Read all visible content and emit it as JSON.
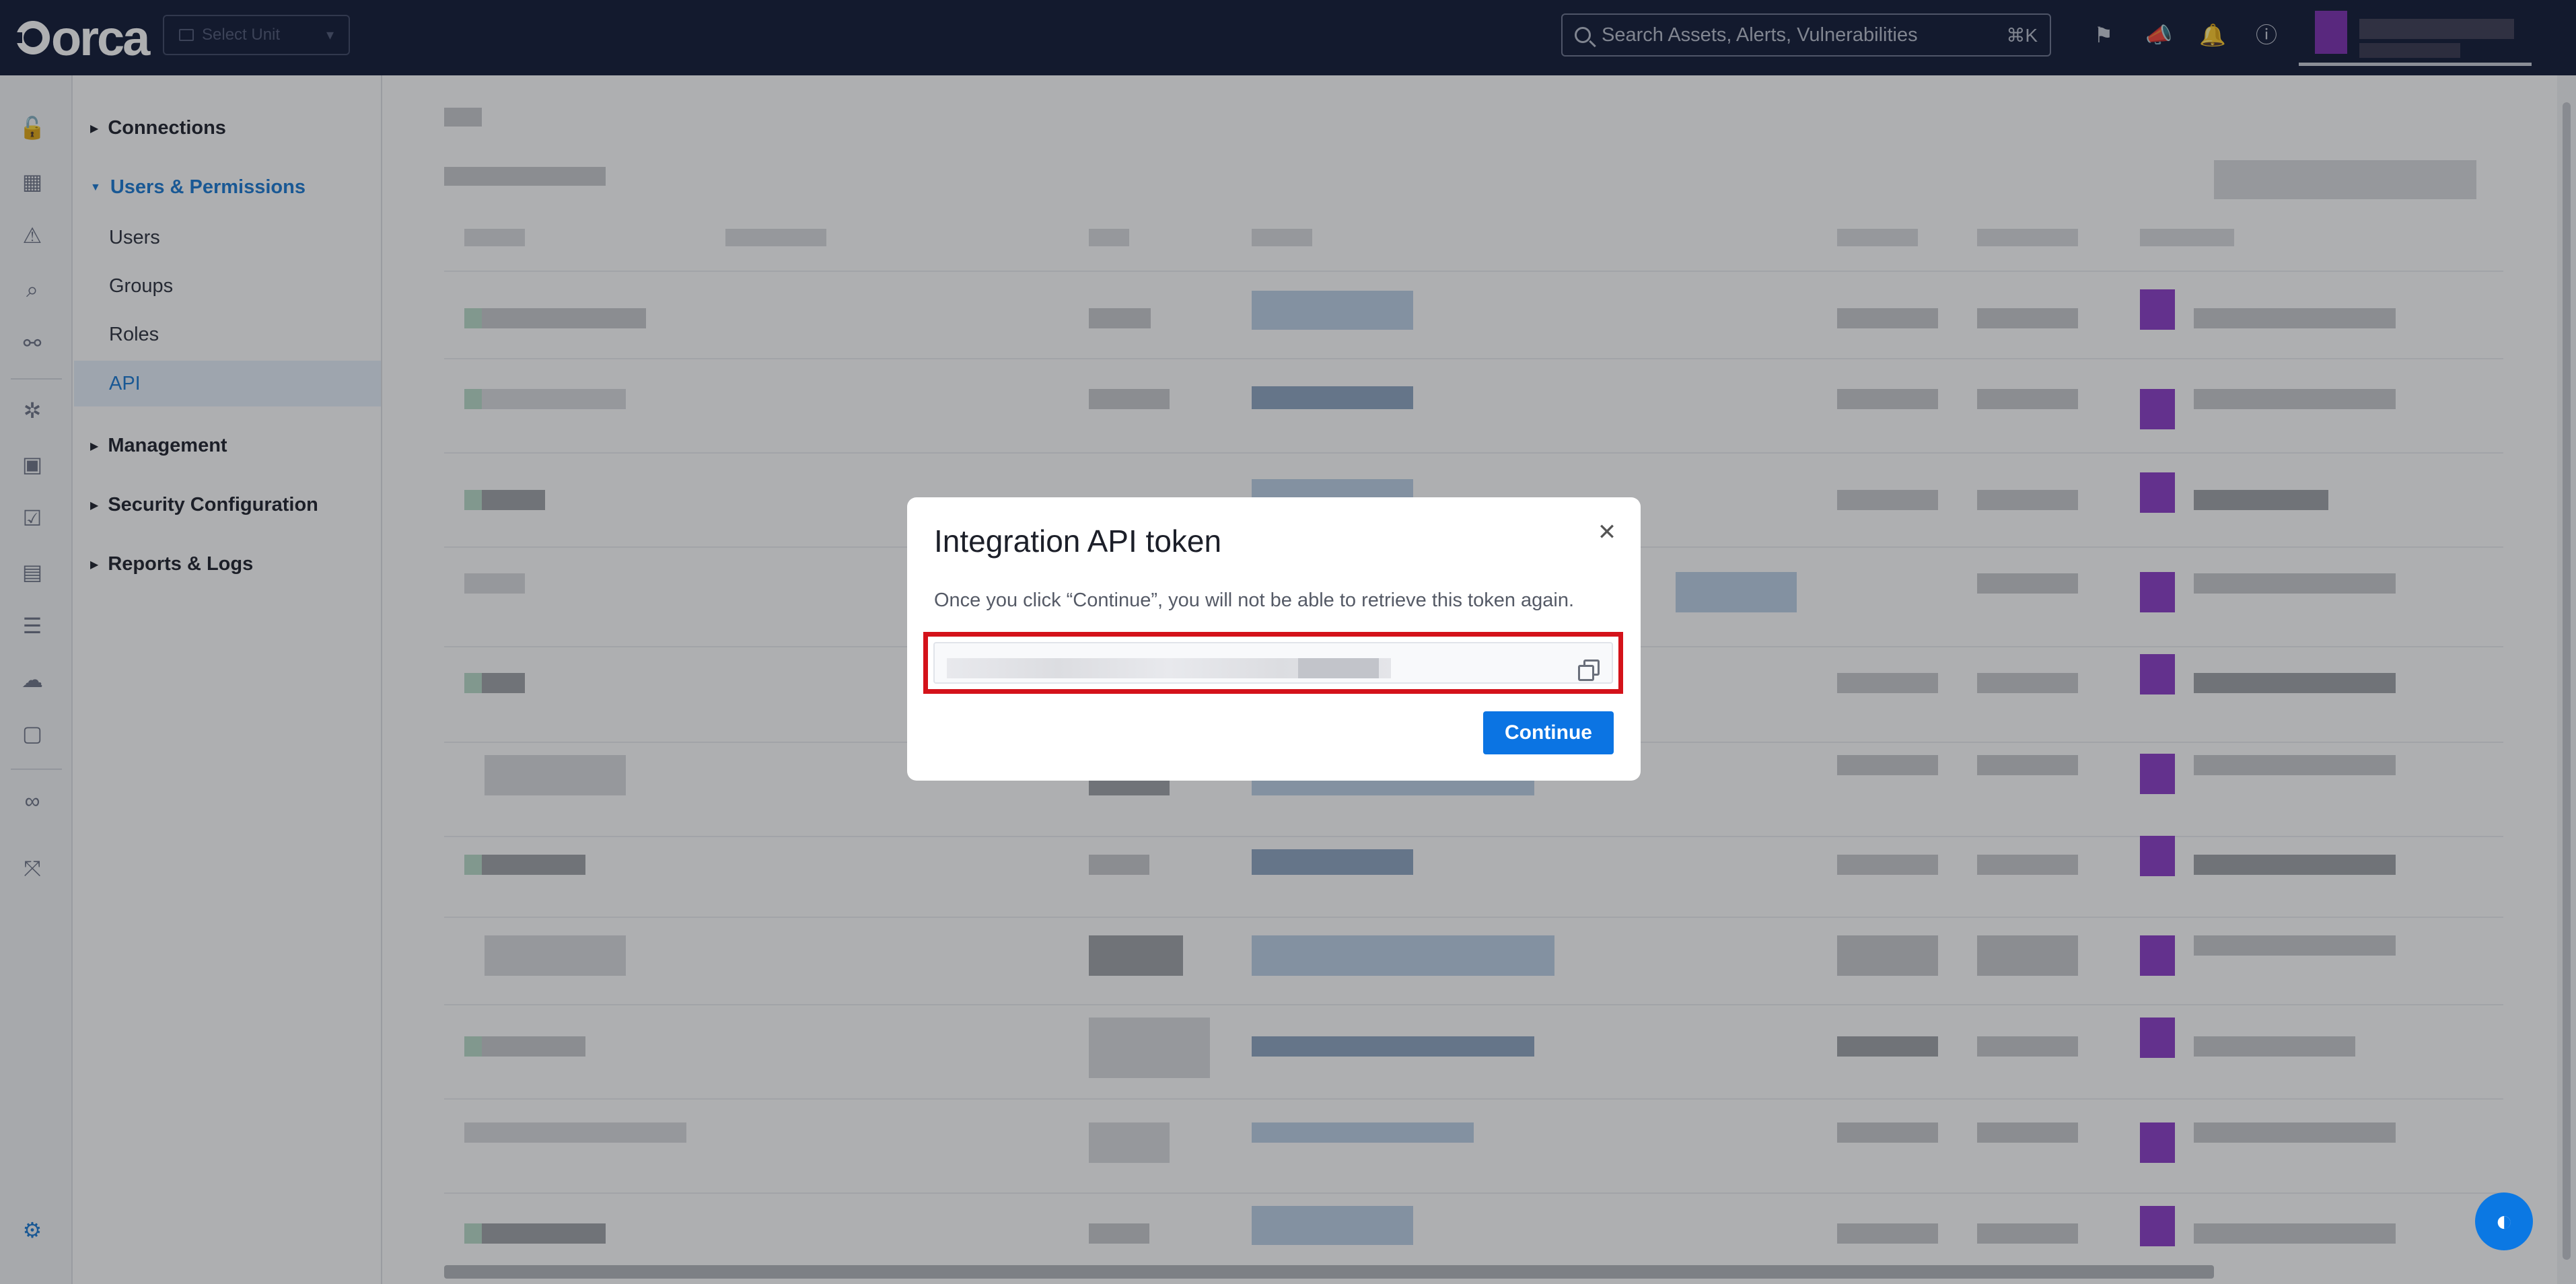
{
  "app": {
    "logo_text": "orca"
  },
  "header": {
    "unit_select": {
      "placeholder": "Select Unit"
    },
    "search": {
      "placeholder": "Search Assets, Alerts, Vulnerabilities",
      "shortcut": "⌘K"
    },
    "icons": [
      "flag-icon",
      "megaphone-icon",
      "bell-icon",
      "help-icon"
    ]
  },
  "rail": {
    "icons": [
      "lock-icon",
      "dashboard-icon",
      "alert-icon",
      "search-icon",
      "graph-icon",
      "compliance-icon",
      "inventory-icon",
      "task-icon",
      "report-icon",
      "database-icon",
      "cloud-icon",
      "user-icon",
      "infinity-icon",
      "workflow-icon",
      "settings-icon"
    ]
  },
  "sidebar": {
    "sections": [
      {
        "label": "Connections"
      },
      {
        "label": "Users & Permissions",
        "items": [
          {
            "label": "Users"
          },
          {
            "label": "Groups"
          },
          {
            "label": "Roles"
          },
          {
            "label": "API"
          }
        ]
      },
      {
        "label": "Management"
      },
      {
        "label": "Security Configuration"
      },
      {
        "label": "Reports & Logs"
      }
    ]
  },
  "modal": {
    "title": "Integration API token",
    "description": "Once you click “Continue”, you will not be able to retrieve this token again.",
    "continue_label": "Continue"
  },
  "colors": {
    "accent": "#1677d2",
    "header_bg": "#0d1633",
    "highlight": "#d4121a",
    "button": "#0b74e3"
  }
}
